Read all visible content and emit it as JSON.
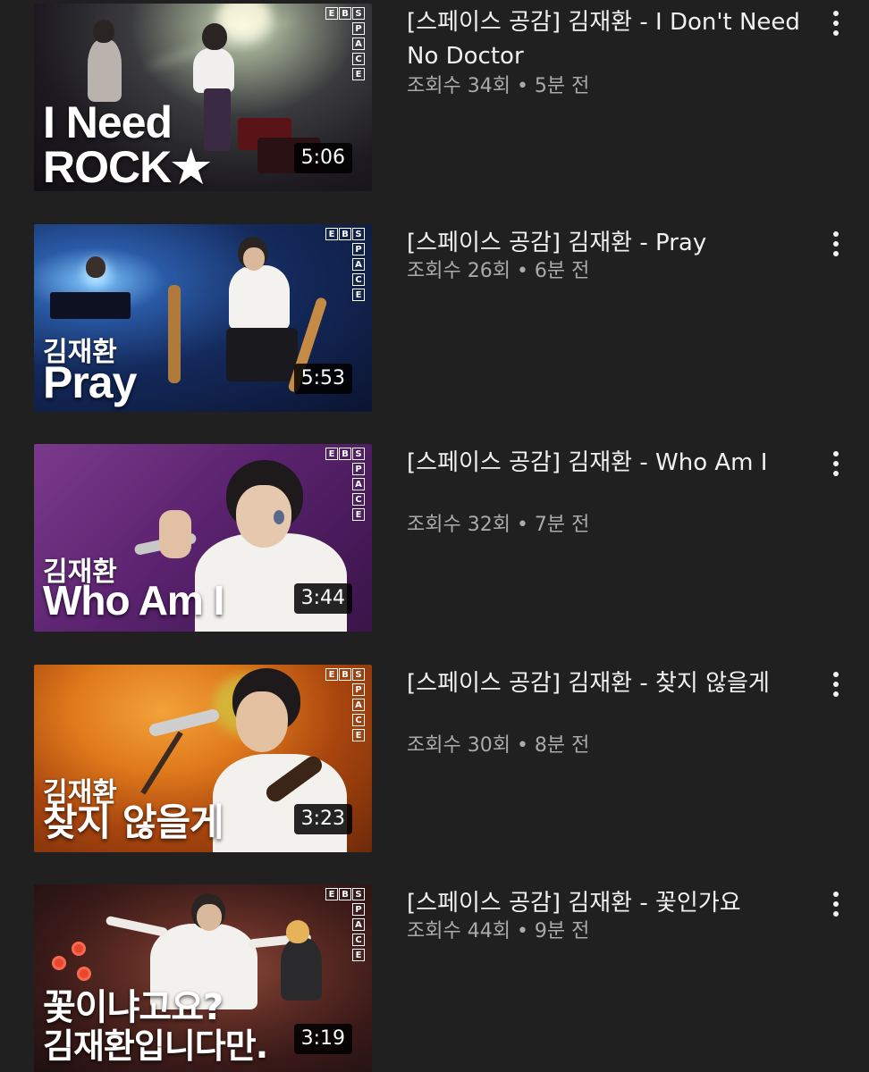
{
  "videos": [
    {
      "title": "[스페이스 공감] 김재환 - I Don't Need No Doctor",
      "meta": "조회수 34회 • 5분 전",
      "duration": "5:06",
      "thumb_text_sub": "",
      "thumb_text_main1": "I Need",
      "thumb_text_main2": "ROCK★"
    },
    {
      "title": "[스페이스 공감] 김재환 - Pray",
      "meta": "조회수 26회 • 6분 전",
      "duration": "5:53",
      "thumb_text_sub": "김재환",
      "thumb_text_main1": "Pray",
      "thumb_text_main2": ""
    },
    {
      "title": "[스페이스 공감] 김재환 - Who Am I",
      "meta": "조회수 32회 • 7분 전",
      "duration": "3:44",
      "thumb_text_sub": "김재환",
      "thumb_text_main1": "Who Am I",
      "thumb_text_main2": ""
    },
    {
      "title": "[스페이스 공감] 김재환 - 찾지 않을게",
      "meta": "조회수 30회 • 8분 전",
      "duration": "3:23",
      "thumb_text_sub": "김재환",
      "thumb_text_main1": "찾지 않을게",
      "thumb_text_main2": ""
    },
    {
      "title": "[스페이스 공감] 김재환 - 꽃인가요",
      "meta": "조회수 44회 • 9분 전",
      "duration": "3:19",
      "thumb_text_sub": "",
      "thumb_text_main1": "꽃이냐고요?",
      "thumb_text_main2": "김재환입니다만."
    }
  ],
  "ebs_logo": {
    "row": [
      "E",
      "B",
      "S"
    ],
    "column": [
      "P",
      "A",
      "C",
      "E"
    ]
  },
  "icons": {
    "menu": "more-vert-icon"
  },
  "colors": {
    "background": "#202020",
    "title_text": "#f1f1f1",
    "meta_text": "#aaaaaa"
  }
}
